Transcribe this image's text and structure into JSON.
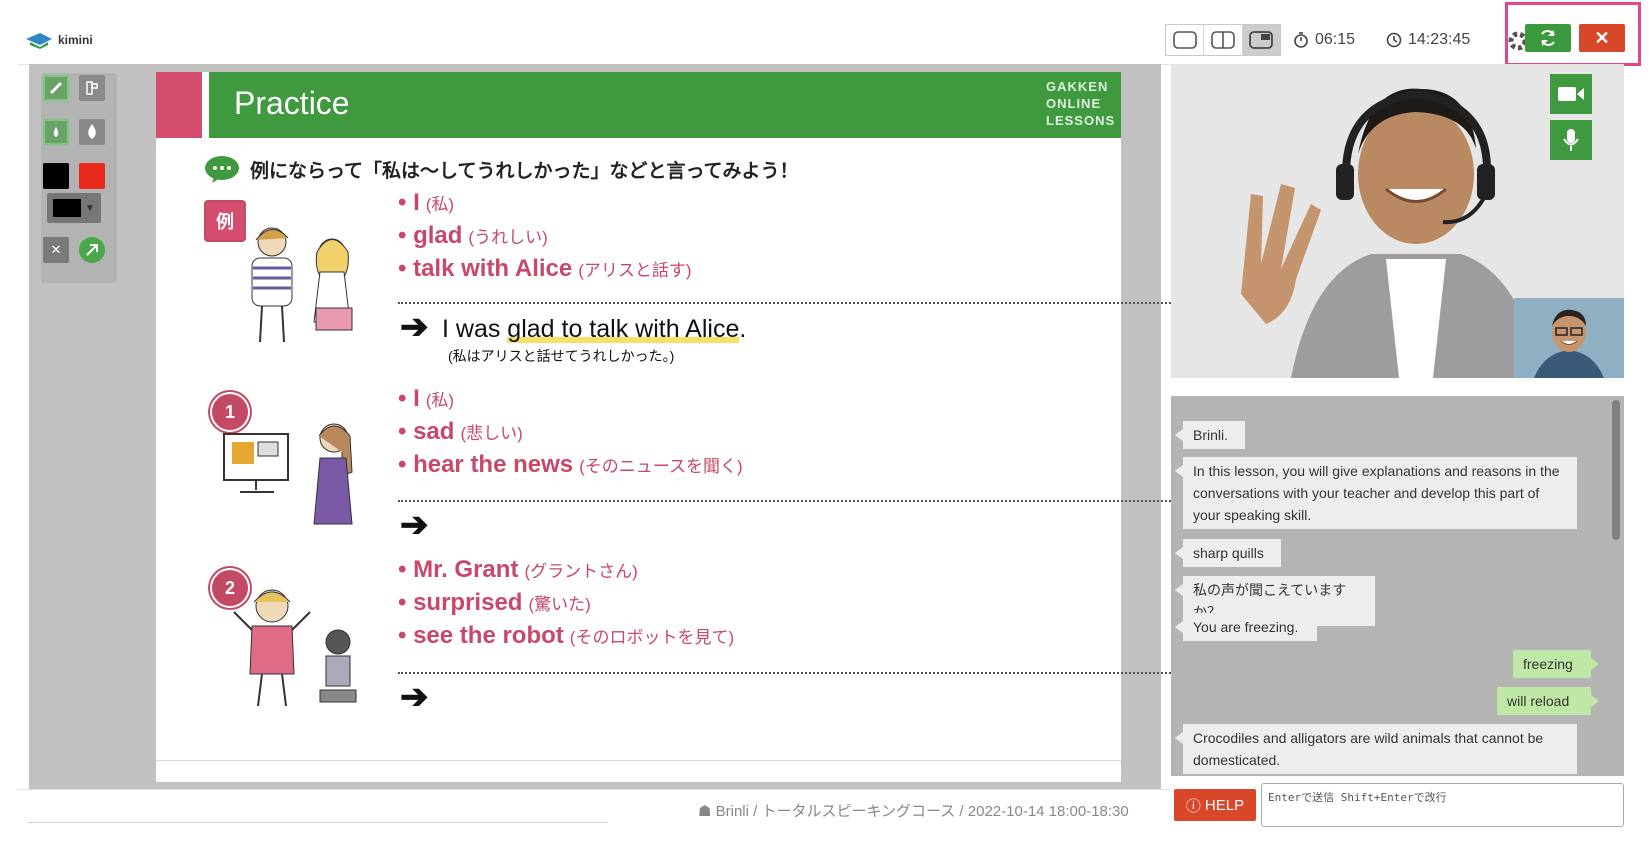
{
  "app": {
    "brand": "kimini"
  },
  "toolbar": {
    "layout_modes": [
      "single",
      "split",
      "split-with-video"
    ],
    "elapsed": "06:15",
    "clock": "14:23:45",
    "colors": {
      "refresh": "#3c9a3c",
      "close": "#d9472b",
      "highlight_frame": "#e2478a"
    }
  },
  "drawing_tools": {
    "items": [
      "pen",
      "stamp",
      "drop-small",
      "drop-large",
      "black",
      "red",
      "color-dropdown",
      "clear",
      "pointer"
    ],
    "colors": {
      "black": "#000000",
      "red": "#e8291c"
    }
  },
  "slide": {
    "title": "Practice",
    "publisher": [
      "GAKKEN",
      "ONLINE",
      "LESSONS"
    ],
    "instruction": "例にならって「私は〜してうれしかった」などと言ってみよう！",
    "example_label": "例",
    "example": {
      "bullets": [
        {
          "en": "I",
          "jp": "(私)"
        },
        {
          "en": "glad",
          "jp": "(うれしい)"
        },
        {
          "en": "talk with Alice",
          "jp": "(アリスと話す)"
        }
      ],
      "answer_prefix": "I was ",
      "answer_hl": "glad to talk with Alice",
      "answer_suffix": ".",
      "answer_jp": "(私はアリスと話せてうれしかった。)"
    },
    "items": [
      {
        "number": "1",
        "bullets": [
          {
            "en": "I",
            "jp": "(私)"
          },
          {
            "en": "sad",
            "jp": "(悲しい)"
          },
          {
            "en": "hear the news",
            "jp": "(そのニュースを聞く)"
          }
        ]
      },
      {
        "number": "2",
        "bullets": [
          {
            "en": "Mr. Grant",
            "jp": "(グラントさん)"
          },
          {
            "en": "surprised",
            "jp": "(驚いた)"
          },
          {
            "en": "see the robot",
            "jp": "(そのロボットを見て)"
          }
        ]
      }
    ],
    "arrow": "➔",
    "colors": {
      "header_green": "#3f9a3f",
      "accent_pink": "#c8486b"
    }
  },
  "status": {
    "lesson_info": "Brinli / トータルスピーキングコース / 2022-10-14 18:00-18:30"
  },
  "chat": {
    "messages": [
      {
        "side": "left",
        "text": "Brinli."
      },
      {
        "side": "left",
        "text": "In this lesson, you will give explanations and reasons in the conversations with your teacher and develop this part of your speaking skill."
      },
      {
        "side": "left",
        "text": "sharp quills"
      },
      {
        "side": "left",
        "text": "私の声が聞こえていますか？"
      },
      {
        "side": "left",
        "text": "You are freezing."
      },
      {
        "side": "right",
        "text": "freezing"
      },
      {
        "side": "right",
        "text": "will reload"
      },
      {
        "side": "left",
        "text": "Crocodiles and alligators are wild animals that cannot be domesticated."
      }
    ],
    "help_label": "HELP",
    "input_placeholder": "Enterで送信 Shift+Enterで改行"
  }
}
